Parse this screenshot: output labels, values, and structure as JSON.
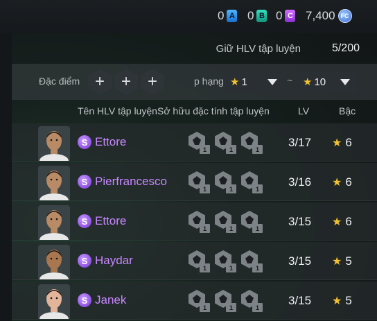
{
  "currencies": [
    {
      "icon": "a-token-icon",
      "letter": "A",
      "value": "0"
    },
    {
      "icon": "b-token-icon",
      "letter": "B",
      "value": "0"
    },
    {
      "icon": "c-token-icon",
      "letter": "C",
      "value": "0"
    },
    {
      "icon": "fc-coin-icon",
      "letter": "FC",
      "value": "7,400"
    }
  ],
  "keep": {
    "label": "Giữ HLV tập luyện",
    "value": "5/200"
  },
  "filter": {
    "trait_label": "Đặc điểm c",
    "plus": "+",
    "rank_label": "p hạng",
    "min_rank": "1",
    "max_rank": "10",
    "tilde": "~",
    "star": "★"
  },
  "columns": {
    "name": "Tên HLV tập luyện",
    "traits": "Sở hữu đặc tính tập luyện",
    "lv": "LV",
    "grade": "Bậc"
  },
  "coaches": [
    {
      "badge": "S",
      "name": "Ettore",
      "traits": [
        "1",
        "1",
        "1"
      ],
      "lv": "3/17",
      "grade": "6",
      "skin": "#b88a66"
    },
    {
      "badge": "S",
      "name": "Pierfrancesco",
      "traits": [
        "1",
        "1",
        "1"
      ],
      "lv": "3/16",
      "grade": "6",
      "skin": "#b88a66"
    },
    {
      "badge": "S",
      "name": "Ettore",
      "traits": [
        "1",
        "1",
        "1"
      ],
      "lv": "3/15",
      "grade": "6",
      "skin": "#b88a66"
    },
    {
      "badge": "S",
      "name": "Haydar",
      "traits": [
        "1",
        "1",
        "1"
      ],
      "lv": "3/15",
      "grade": "5",
      "skin": "#a9774f"
    },
    {
      "badge": "S",
      "name": "Janek",
      "traits": [
        "1",
        "1",
        "1"
      ],
      "lv": "3/15",
      "grade": "5",
      "skin": "#e2b49a"
    }
  ],
  "colors": {
    "accent_name": "#c887ff",
    "star": "#f2c12e"
  }
}
